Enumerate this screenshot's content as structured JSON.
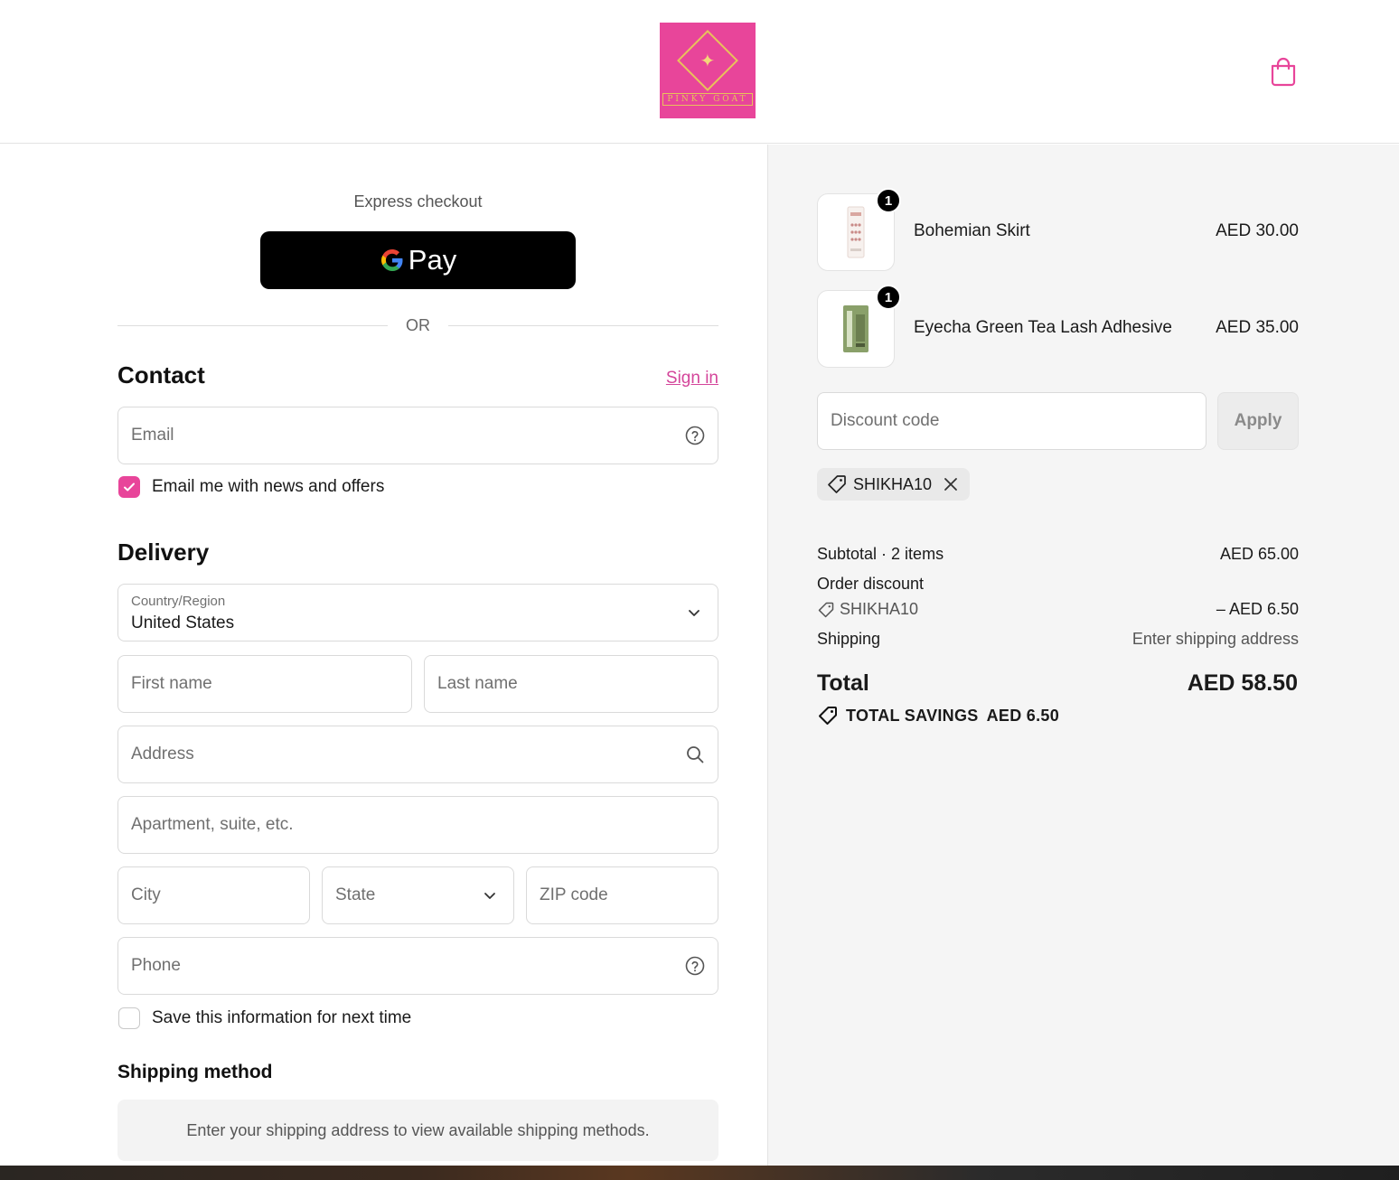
{
  "header": {
    "logo_text": "PINKY GOAT",
    "cart_icon": "shopping-bag-icon",
    "brand_color": "#e8459a"
  },
  "express": {
    "label": "Express checkout",
    "gpay_label": "Pay",
    "or_label": "OR"
  },
  "contact": {
    "title": "Contact",
    "signin_label": "Sign in",
    "email_placeholder": "Email",
    "newsletter_label": "Email me with news and offers",
    "newsletter_checked": true
  },
  "delivery": {
    "title": "Delivery",
    "country_label": "Country/Region",
    "country_value": "United States",
    "first_name_placeholder": "First name",
    "last_name_placeholder": "Last name",
    "address_placeholder": "Address",
    "apartment_placeholder": "Apartment, suite, etc.",
    "city_placeholder": "City",
    "state_placeholder": "State",
    "zip_placeholder": "ZIP code",
    "phone_placeholder": "Phone",
    "save_info_label": "Save this information for next time",
    "save_info_checked": false
  },
  "shipping_method": {
    "title": "Shipping method",
    "message": "Enter your shipping address to view available shipping methods."
  },
  "order": {
    "items": [
      {
        "name": "Bohemian Skirt",
        "price": "AED 30.00",
        "quantity": "1"
      },
      {
        "name": "Eyecha Green Tea Lash Adhesive",
        "price": "AED 35.00",
        "quantity": "1"
      }
    ],
    "discount_placeholder": "Discount code",
    "apply_label": "Apply",
    "applied_code": "SHIKHA10",
    "subtotal_label": "Subtotal · 2 items",
    "subtotal_value": "AED 65.00",
    "order_discount_label": "Order discount",
    "discount_code": "SHIKHA10",
    "discount_value": "– AED 6.50",
    "shipping_label": "Shipping",
    "shipping_value": "Enter shipping address",
    "total_label": "Total",
    "total_value": "AED 58.50",
    "savings_label": "TOTAL SAVINGS",
    "savings_value": "AED 6.50"
  }
}
